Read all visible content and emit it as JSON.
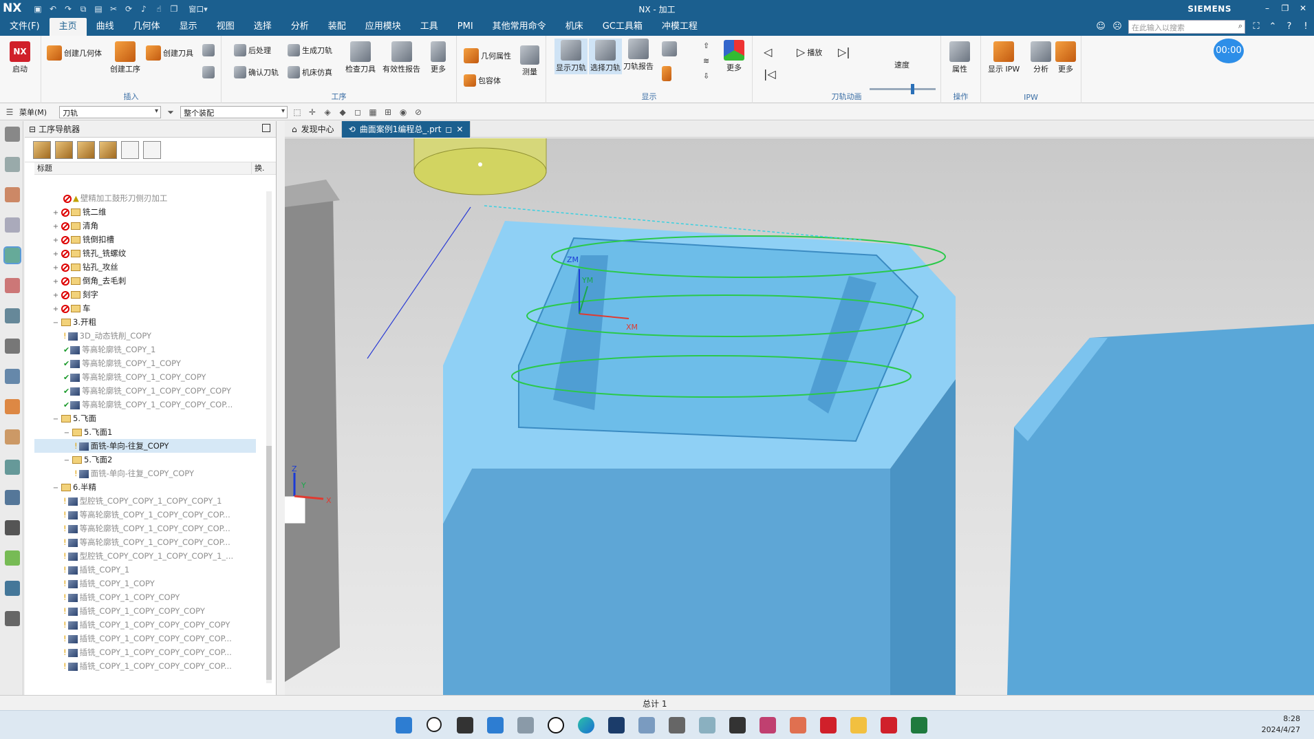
{
  "titlebar": {
    "app_logo": "NX",
    "title": "NX - 加工",
    "brand": "SIEMENS",
    "window_label": "窗口"
  },
  "menu": {
    "items": [
      "文件(F)",
      "主页",
      "曲线",
      "几何体",
      "显示",
      "视图",
      "选择",
      "分析",
      "装配",
      "应用模块",
      "工具",
      "PMI",
      "其他常用命令",
      "机床",
      "GC工具箱",
      "冲模工程"
    ],
    "search_placeholder": "在此输入以搜索"
  },
  "ribbon": {
    "start": {
      "label": "启动",
      "icon": "NX"
    },
    "insert": {
      "label": "插入",
      "create_geometry": "创建几何体",
      "create_op": "创建工序",
      "create_tool": "创建刀具"
    },
    "operation": {
      "label": "工序",
      "postprocess": "后处理",
      "gen_toolpath": "生成刀轨",
      "verify_toolpath": "确认刀轨",
      "machine_sim": "机床仿真",
      "check_tool": "检查刀具",
      "validity_report": "有效性报告",
      "more": "更多"
    },
    "misc": {
      "geom_props": "几何属性",
      "measure": "测量",
      "wrap_body": "包容体"
    },
    "display": {
      "label": "显示",
      "show_toolpath": "显示刀轨",
      "select_toolpath": "选择刀轨",
      "toolpath_report": "刀轨报告",
      "more": "更多"
    },
    "animation": {
      "label": "刀轨动画",
      "play": "播放",
      "speed": "速度"
    },
    "operate": {
      "label": "操作",
      "props": "属性"
    },
    "ipw": {
      "label": "IPW",
      "show_ipw": "显示 IPW",
      "analyze": "分析",
      "more": "更多"
    },
    "timer": "00:00"
  },
  "toolbar2": {
    "menu_label": "菜单(M)",
    "filter_value": "刀轨",
    "assembly_value": "整个装配"
  },
  "navigator": {
    "title": "工序导航器",
    "col_title": "标题",
    "col_change": "换.",
    "rows": [
      {
        "text": "壁精加工鼓形刀侧刃加工",
        "indent": 2,
        "kind": "warn",
        "grey": true
      },
      {
        "text": "铣二维",
        "indent": 1,
        "kind": "folder-no"
      },
      {
        "text": "清角",
        "indent": 1,
        "kind": "folder-no"
      },
      {
        "text": "铣倒扣槽",
        "indent": 1,
        "kind": "folder-no"
      },
      {
        "text": "铣孔_铣螺纹",
        "indent": 1,
        "kind": "folder-no"
      },
      {
        "text": "钻孔_攻丝",
        "indent": 1,
        "kind": "folder-no"
      },
      {
        "text": "倒角_去毛刺",
        "indent": 1,
        "kind": "folder-no"
      },
      {
        "text": "刻字",
        "indent": 1,
        "kind": "folder-no"
      },
      {
        "text": "车",
        "indent": 1,
        "kind": "folder-no"
      },
      {
        "text": "3.开粗",
        "indent": 1,
        "kind": "folder"
      },
      {
        "text": "3D_动态铣削_COPY",
        "indent": 2,
        "kind": "op",
        "grey": true
      },
      {
        "text": "等高轮廓铣_COPY_1",
        "indent": 2,
        "kind": "op-chk",
        "grey": true
      },
      {
        "text": "等高轮廓铣_COPY_1_COPY",
        "indent": 2,
        "kind": "op-chk",
        "grey": true
      },
      {
        "text": "等高轮廓铣_COPY_1_COPY_COPY",
        "indent": 2,
        "kind": "op-chk",
        "grey": true
      },
      {
        "text": "等高轮廓铣_COPY_1_COPY_COPY_COPY",
        "indent": 2,
        "kind": "op-chk",
        "grey": true
      },
      {
        "text": "等高轮廓铣_COPY_1_COPY_COPY_COP...",
        "indent": 2,
        "kind": "op-chk",
        "grey": true
      },
      {
        "text": "5.飞面",
        "indent": 1,
        "kind": "folder"
      },
      {
        "text": "5.飞面1",
        "indent": 2,
        "kind": "folder"
      },
      {
        "text": "面铣-单向-往复_COPY",
        "indent": 3,
        "kind": "op",
        "sel": true
      },
      {
        "text": "5.飞面2",
        "indent": 2,
        "kind": "folder"
      },
      {
        "text": "面铣-单向-往复_COPY_COPY",
        "indent": 3,
        "kind": "op",
        "grey": true
      },
      {
        "text": "6.半精",
        "indent": 1,
        "kind": "folder"
      },
      {
        "text": "型腔铣_COPY_COPY_1_COPY_COPY_1",
        "indent": 2,
        "kind": "op",
        "grey": true
      },
      {
        "text": "等高轮廓铣_COPY_1_COPY_COPY_COP...",
        "indent": 2,
        "kind": "op",
        "grey": true
      },
      {
        "text": "等高轮廓铣_COPY_1_COPY_COPY_COP...",
        "indent": 2,
        "kind": "op",
        "grey": true
      },
      {
        "text": "等高轮廓铣_COPY_1_COPY_COPY_COP...",
        "indent": 2,
        "kind": "op",
        "grey": true
      },
      {
        "text": "型腔铣_COPY_COPY_1_COPY_COPY_1_...",
        "indent": 2,
        "kind": "op",
        "grey": true
      },
      {
        "text": "插铣_COPY_1",
        "indent": 2,
        "kind": "op",
        "grey": true
      },
      {
        "text": "插铣_COPY_1_COPY",
        "indent": 2,
        "kind": "op",
        "grey": true
      },
      {
        "text": "插铣_COPY_1_COPY_COPY",
        "indent": 2,
        "kind": "op",
        "grey": true
      },
      {
        "text": "插铣_COPY_1_COPY_COPY_COPY",
        "indent": 2,
        "kind": "op",
        "grey": true
      },
      {
        "text": "插铣_COPY_1_COPY_COPY_COPY_COPY",
        "indent": 2,
        "kind": "op",
        "grey": true
      },
      {
        "text": "插铣_COPY_1_COPY_COPY_COPY_COP...",
        "indent": 2,
        "kind": "op",
        "grey": true
      },
      {
        "text": "插铣_COPY_1_COPY_COPY_COPY_COP...",
        "indent": 2,
        "kind": "op",
        "grey": true
      },
      {
        "text": "插铣_COPY_1_COPY_COPY_COPY_COP...",
        "indent": 2,
        "kind": "op",
        "grey": true
      }
    ]
  },
  "tabs": [
    {
      "label": "发现中心",
      "active": false
    },
    {
      "label": "曲面案例1编程总_.prt",
      "active": true
    }
  ],
  "viewport": {
    "axis_zm": "ZM",
    "axis_ym": "YM",
    "axis_xm": "XM",
    "triad_z": "Z",
    "triad_y": "Y",
    "triad_x": "X"
  },
  "status": {
    "text": "总计 1"
  },
  "taskbar": {
    "time": "8:28",
    "date": "2024/4/27"
  },
  "colors": {
    "brand": "#1b5f8f",
    "part": "#5ab3e8",
    "cut_tool": "#d6d77a",
    "toolpath": "#2ac94a"
  }
}
